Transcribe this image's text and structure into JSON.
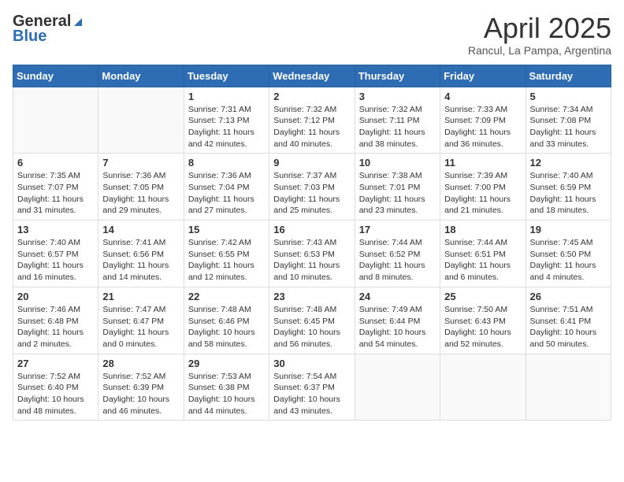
{
  "header": {
    "logo_general": "General",
    "logo_blue": "Blue",
    "title": "April 2025",
    "subtitle": "Rancul, La Pampa, Argentina"
  },
  "days_of_week": [
    "Sunday",
    "Monday",
    "Tuesday",
    "Wednesday",
    "Thursday",
    "Friday",
    "Saturday"
  ],
  "weeks": [
    [
      {
        "day": "",
        "info": ""
      },
      {
        "day": "",
        "info": ""
      },
      {
        "day": "1",
        "info": "Sunrise: 7:31 AM\nSunset: 7:13 PM\nDaylight: 11 hours and 42 minutes."
      },
      {
        "day": "2",
        "info": "Sunrise: 7:32 AM\nSunset: 7:12 PM\nDaylight: 11 hours and 40 minutes."
      },
      {
        "day": "3",
        "info": "Sunrise: 7:32 AM\nSunset: 7:11 PM\nDaylight: 11 hours and 38 minutes."
      },
      {
        "day": "4",
        "info": "Sunrise: 7:33 AM\nSunset: 7:09 PM\nDaylight: 11 hours and 36 minutes."
      },
      {
        "day": "5",
        "info": "Sunrise: 7:34 AM\nSunset: 7:08 PM\nDaylight: 11 hours and 33 minutes."
      }
    ],
    [
      {
        "day": "6",
        "info": "Sunrise: 7:35 AM\nSunset: 7:07 PM\nDaylight: 11 hours and 31 minutes."
      },
      {
        "day": "7",
        "info": "Sunrise: 7:36 AM\nSunset: 7:05 PM\nDaylight: 11 hours and 29 minutes."
      },
      {
        "day": "8",
        "info": "Sunrise: 7:36 AM\nSunset: 7:04 PM\nDaylight: 11 hours and 27 minutes."
      },
      {
        "day": "9",
        "info": "Sunrise: 7:37 AM\nSunset: 7:03 PM\nDaylight: 11 hours and 25 minutes."
      },
      {
        "day": "10",
        "info": "Sunrise: 7:38 AM\nSunset: 7:01 PM\nDaylight: 11 hours and 23 minutes."
      },
      {
        "day": "11",
        "info": "Sunrise: 7:39 AM\nSunset: 7:00 PM\nDaylight: 11 hours and 21 minutes."
      },
      {
        "day": "12",
        "info": "Sunrise: 7:40 AM\nSunset: 6:59 PM\nDaylight: 11 hours and 18 minutes."
      }
    ],
    [
      {
        "day": "13",
        "info": "Sunrise: 7:40 AM\nSunset: 6:57 PM\nDaylight: 11 hours and 16 minutes."
      },
      {
        "day": "14",
        "info": "Sunrise: 7:41 AM\nSunset: 6:56 PM\nDaylight: 11 hours and 14 minutes."
      },
      {
        "day": "15",
        "info": "Sunrise: 7:42 AM\nSunset: 6:55 PM\nDaylight: 11 hours and 12 minutes."
      },
      {
        "day": "16",
        "info": "Sunrise: 7:43 AM\nSunset: 6:53 PM\nDaylight: 11 hours and 10 minutes."
      },
      {
        "day": "17",
        "info": "Sunrise: 7:44 AM\nSunset: 6:52 PM\nDaylight: 11 hours and 8 minutes."
      },
      {
        "day": "18",
        "info": "Sunrise: 7:44 AM\nSunset: 6:51 PM\nDaylight: 11 hours and 6 minutes."
      },
      {
        "day": "19",
        "info": "Sunrise: 7:45 AM\nSunset: 6:50 PM\nDaylight: 11 hours and 4 minutes."
      }
    ],
    [
      {
        "day": "20",
        "info": "Sunrise: 7:46 AM\nSunset: 6:48 PM\nDaylight: 11 hours and 2 minutes."
      },
      {
        "day": "21",
        "info": "Sunrise: 7:47 AM\nSunset: 6:47 PM\nDaylight: 11 hours and 0 minutes."
      },
      {
        "day": "22",
        "info": "Sunrise: 7:48 AM\nSunset: 6:46 PM\nDaylight: 10 hours and 58 minutes."
      },
      {
        "day": "23",
        "info": "Sunrise: 7:48 AM\nSunset: 6:45 PM\nDaylight: 10 hours and 56 minutes."
      },
      {
        "day": "24",
        "info": "Sunrise: 7:49 AM\nSunset: 6:44 PM\nDaylight: 10 hours and 54 minutes."
      },
      {
        "day": "25",
        "info": "Sunrise: 7:50 AM\nSunset: 6:43 PM\nDaylight: 10 hours and 52 minutes."
      },
      {
        "day": "26",
        "info": "Sunrise: 7:51 AM\nSunset: 6:41 PM\nDaylight: 10 hours and 50 minutes."
      }
    ],
    [
      {
        "day": "27",
        "info": "Sunrise: 7:52 AM\nSunset: 6:40 PM\nDaylight: 10 hours and 48 minutes."
      },
      {
        "day": "28",
        "info": "Sunrise: 7:52 AM\nSunset: 6:39 PM\nDaylight: 10 hours and 46 minutes."
      },
      {
        "day": "29",
        "info": "Sunrise: 7:53 AM\nSunset: 6:38 PM\nDaylight: 10 hours and 44 minutes."
      },
      {
        "day": "30",
        "info": "Sunrise: 7:54 AM\nSunset: 6:37 PM\nDaylight: 10 hours and 43 minutes."
      },
      {
        "day": "",
        "info": ""
      },
      {
        "day": "",
        "info": ""
      },
      {
        "day": "",
        "info": ""
      }
    ]
  ]
}
